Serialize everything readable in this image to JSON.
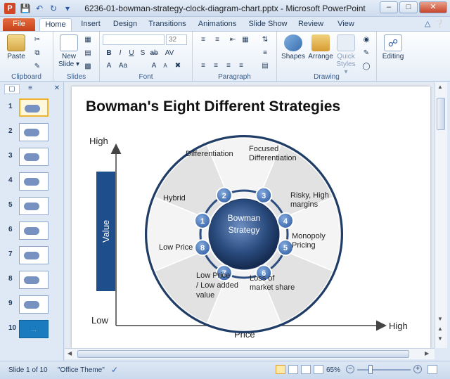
{
  "window": {
    "app_icon": "P",
    "title": "6236-01-bowman-strategy-clock-diagram-chart.pptx - Microsoft PowerPoint",
    "minimize": "–",
    "maximize": "□",
    "close": "✕"
  },
  "tabs": [
    "File",
    "Home",
    "Insert",
    "Design",
    "Transitions",
    "Animations",
    "Slide Show",
    "Review",
    "View"
  ],
  "ribbon": {
    "clipboard": {
      "paste": "Paste",
      "label": "Clipboard"
    },
    "slides": {
      "new_slide": "New Slide ▾",
      "label": "Slides"
    },
    "font": {
      "font_size": "32",
      "label": "Font"
    },
    "paragraph": {
      "label": "Paragraph"
    },
    "drawing": {
      "shapes": "Shapes",
      "arrange": "Arrange",
      "quick_styles": "Quick Styles ▾",
      "label": "Drawing"
    },
    "editing": {
      "editing": "Editing"
    }
  },
  "thumbnails": [
    {
      "num": "1",
      "selected": true
    },
    {
      "num": "2"
    },
    {
      "num": "3"
    },
    {
      "num": "4"
    },
    {
      "num": "5"
    },
    {
      "num": "6"
    },
    {
      "num": "7"
    },
    {
      "num": "8"
    },
    {
      "num": "9"
    },
    {
      "num": "10",
      "blue": true,
      "text": "…"
    }
  ],
  "slide": {
    "title": "Bowman's Eight Different Strategies",
    "y_high": "High",
    "y_low": "Low",
    "y_axis": "Value",
    "x_axis": "Price",
    "x_high": "High",
    "center": "Bowman\nStrategy",
    "center_line1": "Bowman",
    "center_line2": "Strategy",
    "segments": [
      {
        "num": "1",
        "label": "Hybrid"
      },
      {
        "num": "2",
        "label": "Differentiation"
      },
      {
        "num": "3",
        "label": "Focused Differentiation"
      },
      {
        "num": "4",
        "label": "Risky, High margins"
      },
      {
        "num": "5",
        "label": "Monopoly Pricing"
      },
      {
        "num": "6",
        "label": "Loss of market share"
      },
      {
        "num": "7",
        "label": "Low Price / Low added value"
      },
      {
        "num": "8",
        "label": "Low Price"
      }
    ],
    "label_lines": {
      "diff": "Differentiation",
      "focused1": "Focused",
      "focused2": "Differentiation",
      "risky1": "Risky, High",
      "risky2": "margins",
      "hybrid": "Hybrid",
      "mono1": "Monopoly",
      "mono2": "Pricing",
      "lowprice": "Low Price",
      "lpl1": "Low Price",
      "lpl2": "/ Low added",
      "lpl3": "value",
      "loss1": "Loss of",
      "loss2": "market share"
    },
    "colors": {
      "accent": "#1f4e8c",
      "badge": "#4f7fc0",
      "center": "#2b4d80"
    }
  },
  "status": {
    "slide_info": "Slide 1 of 10",
    "theme": "\"Office Theme\"",
    "zoom": "65%"
  }
}
